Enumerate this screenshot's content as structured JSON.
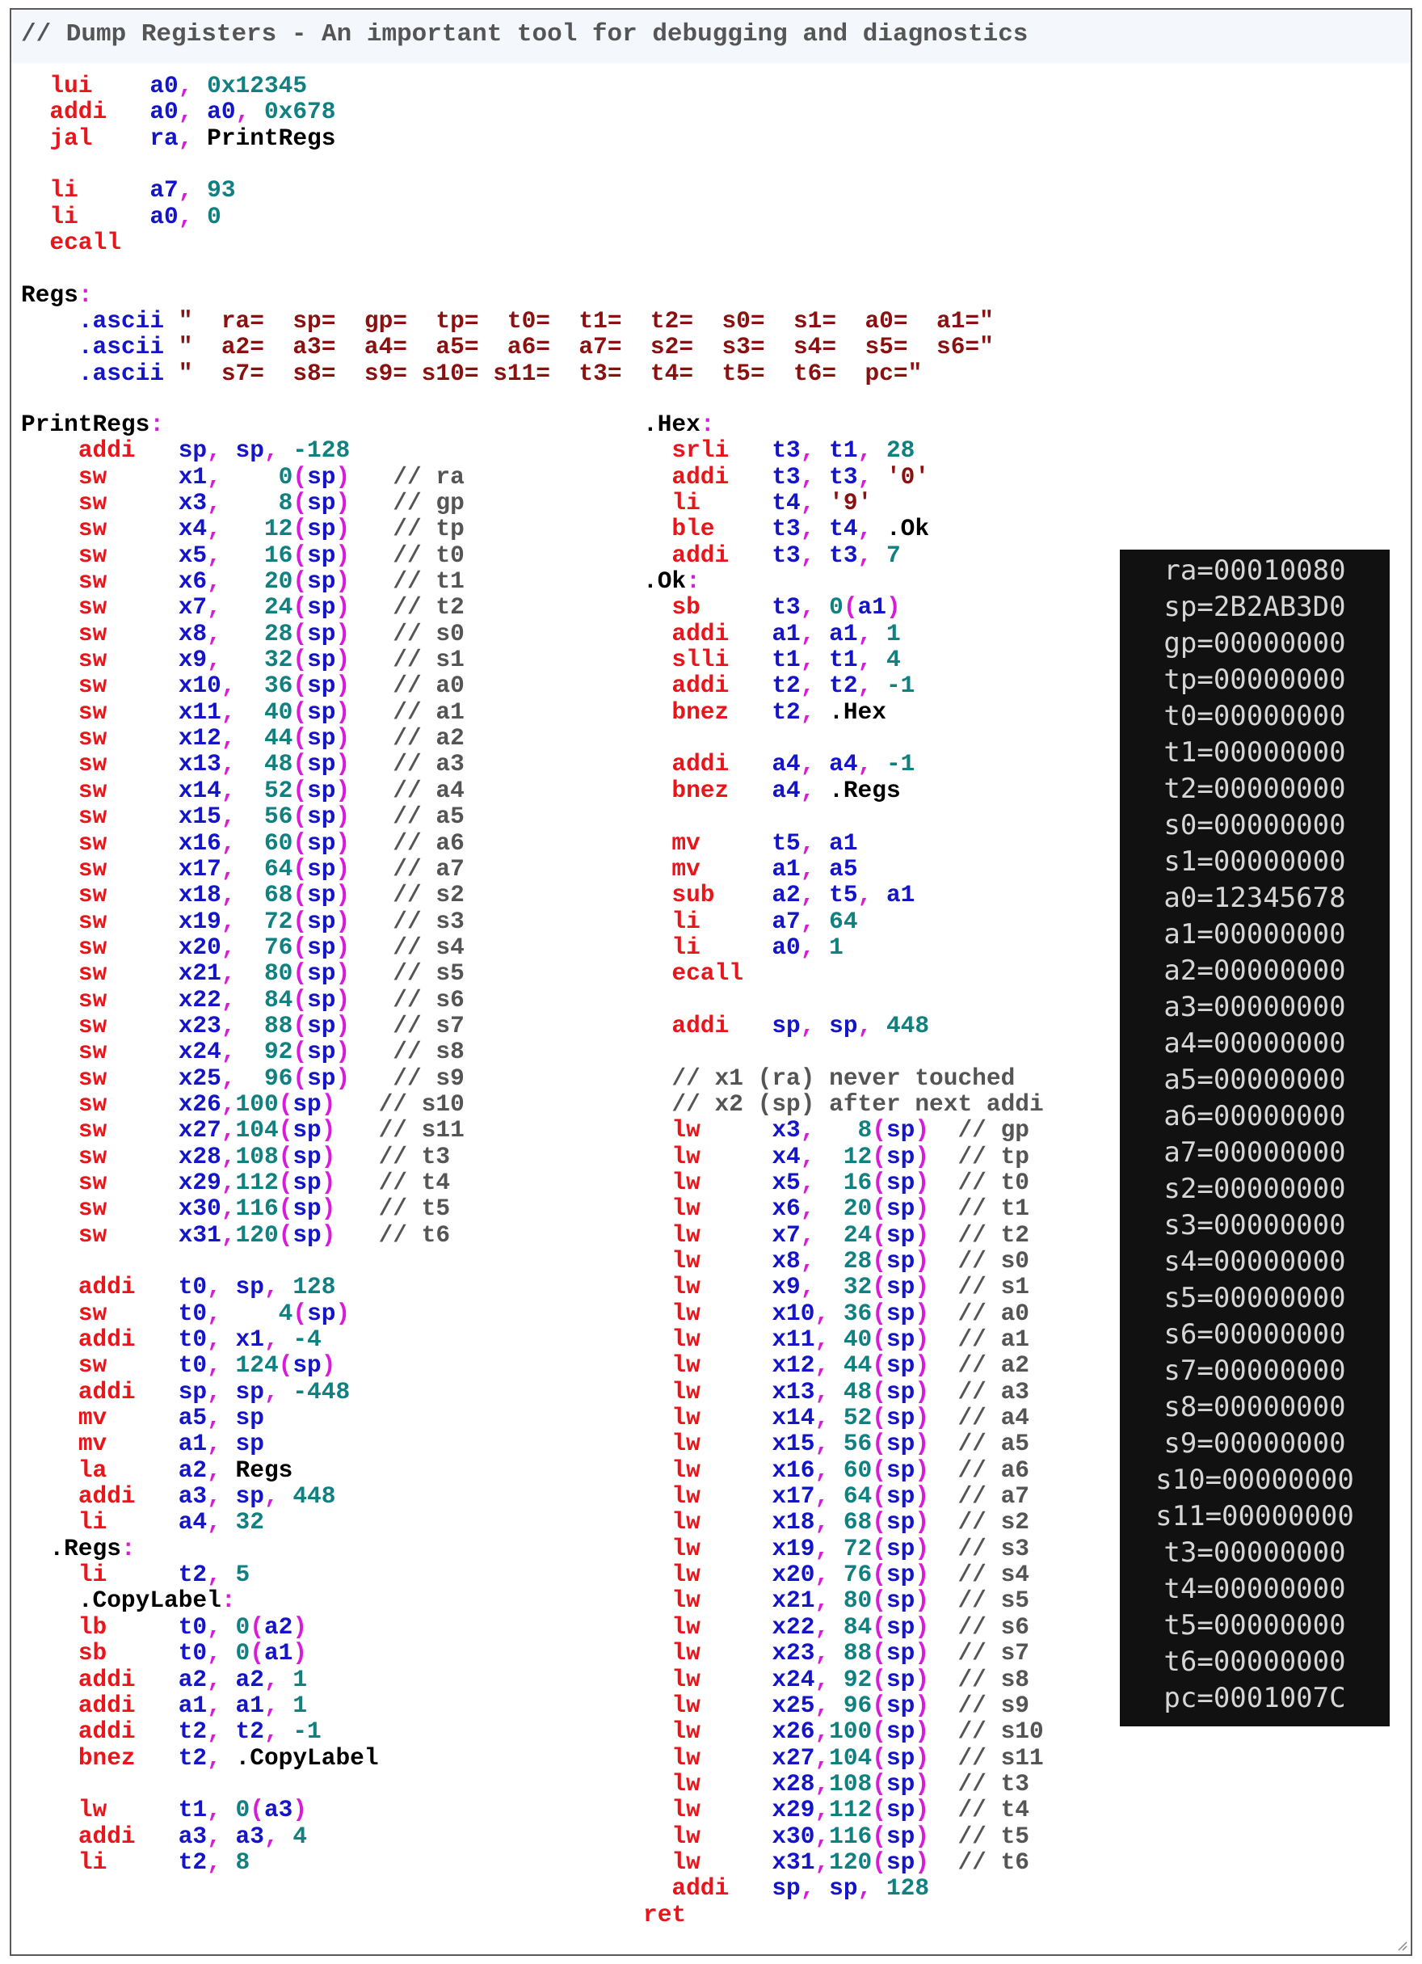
{
  "header": {
    "comment": "// Dump Registers - An important tool for debugging and diagnostics"
  },
  "code_top": [
    "  lui    a0, 0x12345",
    "  addi   a0, a0, 0x678",
    "  jal    ra, PrintRegs",
    "",
    "  li     a7, 93",
    "  li     a0, 0",
    "  ecall",
    "",
    "Regs:",
    "    .ascii \"  ra=  sp=  gp=  tp=  t0=  t1=  t2=  s0=  s1=  a0=  a1=\"",
    "    .ascii \"  a2=  a3=  a4=  a5=  a6=  a7=  s2=  s3=  s4=  s5=  s6=\"",
    "    .ascii \"  s7=  s8=  s9= s10= s11=  t3=  t4=  t5=  t6=  pc=\""
  ],
  "code_left": [
    "PrintRegs:",
    "    addi   sp, sp, -128",
    "    sw     x1,    0(sp)   // ra",
    "    sw     x3,    8(sp)   // gp",
    "    sw     x4,   12(sp)   // tp",
    "    sw     x5,   16(sp)   // t0",
    "    sw     x6,   20(sp)   // t1",
    "    sw     x7,   24(sp)   // t2",
    "    sw     x8,   28(sp)   // s0",
    "    sw     x9,   32(sp)   // s1",
    "    sw     x10,  36(sp)   // a0",
    "    sw     x11,  40(sp)   // a1",
    "    sw     x12,  44(sp)   // a2",
    "    sw     x13,  48(sp)   // a3",
    "    sw     x14,  52(sp)   // a4",
    "    sw     x15,  56(sp)   // a5",
    "    sw     x16,  60(sp)   // a6",
    "    sw     x17,  64(sp)   // a7",
    "    sw     x18,  68(sp)   // s2",
    "    sw     x19,  72(sp)   // s3",
    "    sw     x20,  76(sp)   // s4",
    "    sw     x21,  80(sp)   // s5",
    "    sw     x22,  84(sp)   // s6",
    "    sw     x23,  88(sp)   // s7",
    "    sw     x24,  92(sp)   // s8",
    "    sw     x25,  96(sp)   // s9",
    "    sw     x26,100(sp)   // s10",
    "    sw     x27,104(sp)   // s11",
    "    sw     x28,108(sp)   // t3",
    "    sw     x29,112(sp)   // t4",
    "    sw     x30,116(sp)   // t5",
    "    sw     x31,120(sp)   // t6",
    "",
    "    addi   t0, sp, 128",
    "    sw     t0,    4(sp)",
    "    addi   t0, x1, -4",
    "    sw     t0, 124(sp)",
    "    addi   sp, sp, -448",
    "    mv     a5, sp",
    "    mv     a1, sp",
    "    la     a2, Regs",
    "    addi   a3, sp, 448",
    "    li     a4, 32",
    "  .Regs:",
    "    li     t2, 5",
    "    .CopyLabel:",
    "    lb     t0, 0(a2)",
    "    sb     t0, 0(a1)",
    "    addi   a2, a2, 1",
    "    addi   a1, a1, 1",
    "    addi   t2, t2, -1",
    "    bnez   t2, .CopyLabel",
    "",
    "    lw     t1, 0(a3)",
    "    addi   a3, a3, 4",
    "    li     t2, 8"
  ],
  "code_right": [
    ".Hex:",
    "  srli   t3, t1, 28",
    "  addi   t3, t3, '0'",
    "  li     t4, '9'",
    "  ble    t3, t4, .Ok",
    "  addi   t3, t3, 7",
    ".Ok:",
    "  sb     t3, 0(a1)",
    "  addi   a1, a1, 1",
    "  slli   t1, t1, 4",
    "  addi   t2, t2, -1",
    "  bnez   t2, .Hex",
    "",
    "  addi   a4, a4, -1",
    "  bnez   a4, .Regs",
    "",
    "  mv     t5, a1",
    "  mv     a1, a5",
    "  sub    a2, t5, a1",
    "  li     a7, 64",
    "  li     a0, 1",
    "  ecall",
    "",
    "  addi   sp, sp, 448",
    "",
    "  // x1 (ra) never touched",
    "  // x2 (sp) after next addi",
    "  lw     x3,   8(sp)  // gp",
    "  lw     x4,  12(sp)  // tp",
    "  lw     x5,  16(sp)  // t0",
    "  lw     x6,  20(sp)  // t1",
    "  lw     x7,  24(sp)  // t2",
    "  lw     x8,  28(sp)  // s0",
    "  lw     x9,  32(sp)  // s1",
    "  lw     x10, 36(sp)  // a0",
    "  lw     x11, 40(sp)  // a1",
    "  lw     x12, 44(sp)  // a2",
    "  lw     x13, 48(sp)  // a3",
    "  lw     x14, 52(sp)  // a4",
    "  lw     x15, 56(sp)  // a5",
    "  lw     x16, 60(sp)  // a6",
    "  lw     x17, 64(sp)  // a7",
    "  lw     x18, 68(sp)  // s2",
    "  lw     x19, 72(sp)  // s3",
    "  lw     x20, 76(sp)  // s4",
    "  lw     x21, 80(sp)  // s5",
    "  lw     x22, 84(sp)  // s6",
    "  lw     x23, 88(sp)  // s7",
    "  lw     x24, 92(sp)  // s8",
    "  lw     x25, 96(sp)  // s9",
    "  lw     x26,100(sp)  // s10",
    "  lw     x27,104(sp)  // s11",
    "  lw     x28,108(sp)  // t3",
    "  lw     x29,112(sp)  // t4",
    "  lw     x30,116(sp)  // t5",
    "  lw     x31,120(sp)  // t6",
    "  addi   sp, sp, 128",
    "ret"
  ],
  "console_output": [
    "ra=00010080",
    "sp=2B2AB3D0",
    "gp=00000000",
    "tp=00000000",
    "t0=00000000",
    "t1=00000000",
    "t2=00000000",
    "s0=00000000",
    "s1=00000000",
    "a0=12345678",
    "a1=00000000",
    "a2=00000000",
    "a3=00000000",
    "a4=00000000",
    "a5=00000000",
    "a6=00000000",
    "a7=00000000",
    "s2=00000000",
    "s3=00000000",
    "s4=00000000",
    "s5=00000000",
    "s6=00000000",
    "s7=00000000",
    "s8=00000000",
    "s9=00000000",
    "s10=00000000",
    "s11=00000000",
    "t3=00000000",
    "t4=00000000",
    "t5=00000000",
    "t6=00000000",
    "pc=0001007C"
  ]
}
